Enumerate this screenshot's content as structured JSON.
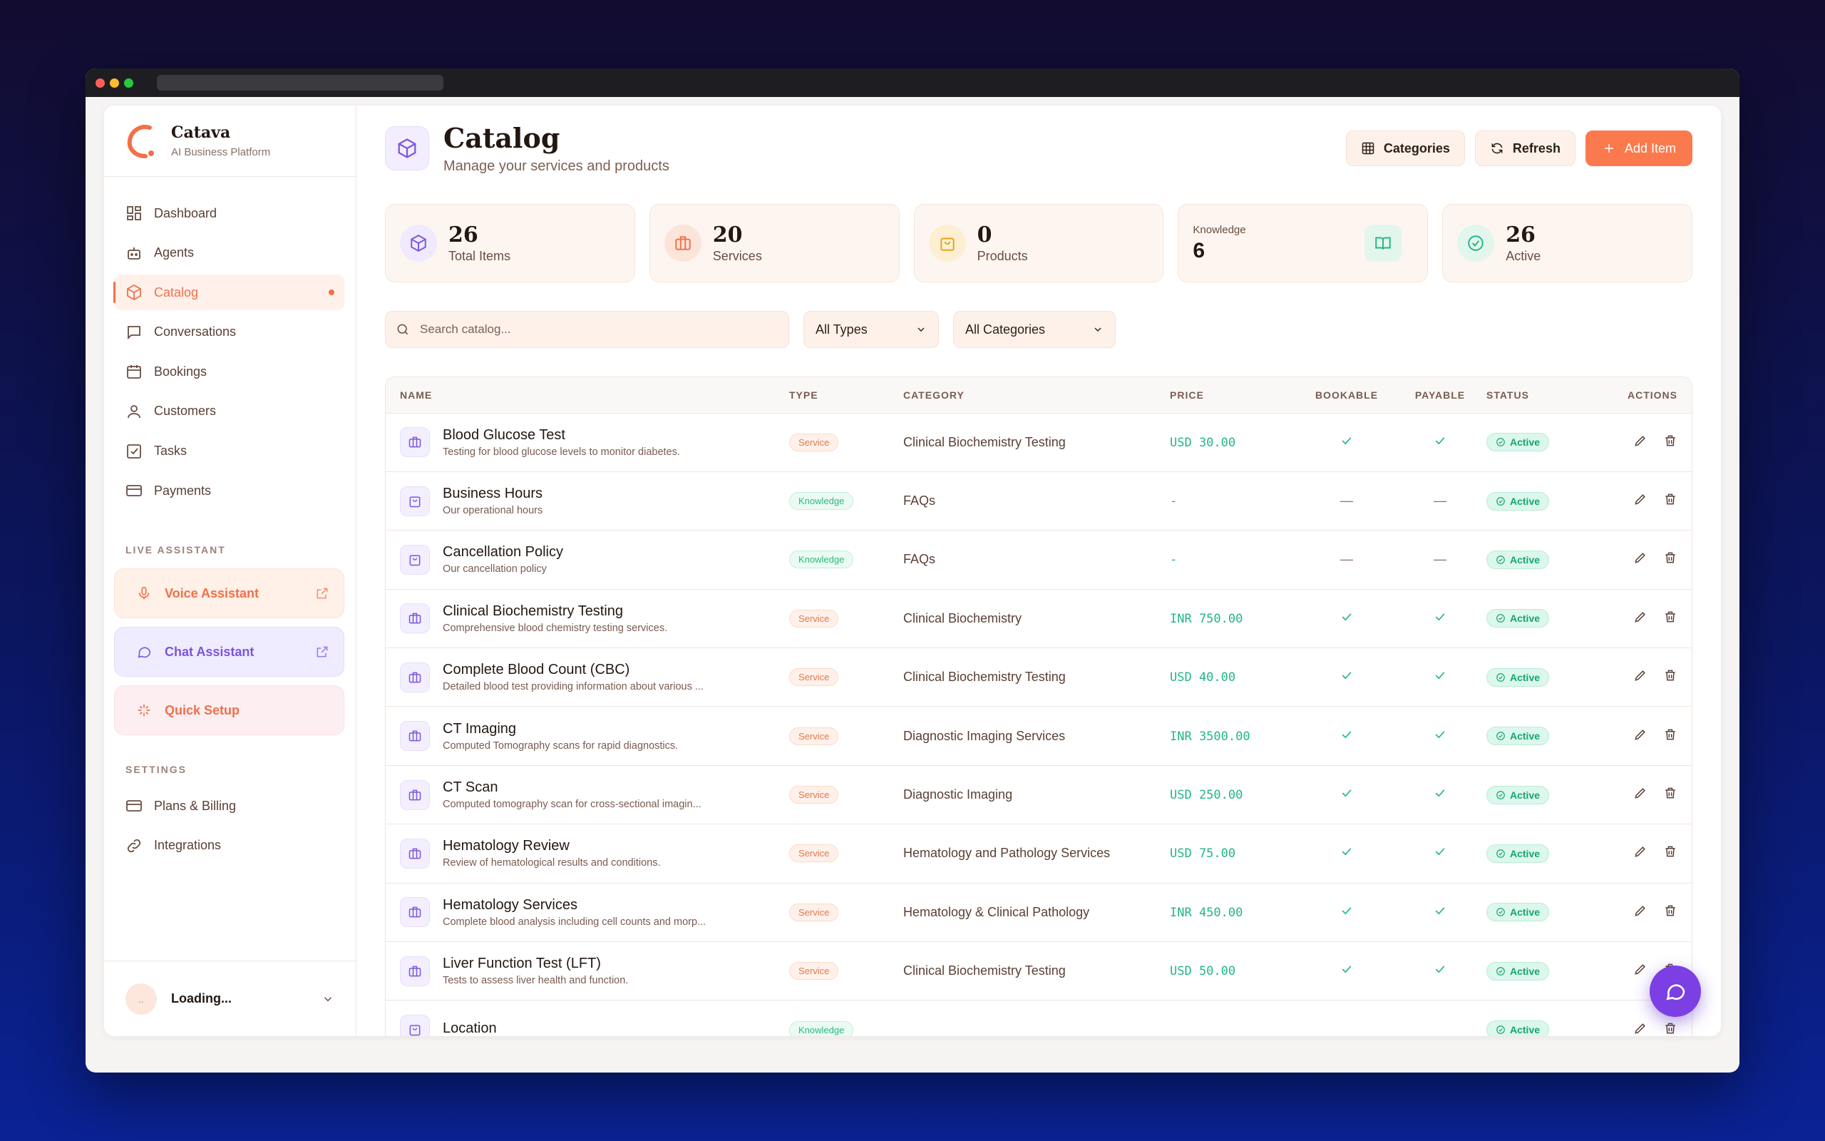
{
  "brand": {
    "name": "Catava",
    "subtitle": "AI Business Platform"
  },
  "nav": [
    {
      "label": "Dashboard",
      "icon": "dashboard-icon"
    },
    {
      "label": "Agents",
      "icon": "robot-icon"
    },
    {
      "label": "Catalog",
      "icon": "package-icon",
      "active": true
    },
    {
      "label": "Conversations",
      "icon": "message-icon"
    },
    {
      "label": "Bookings",
      "icon": "calendar-icon"
    },
    {
      "label": "Customers",
      "icon": "user-icon"
    },
    {
      "label": "Tasks",
      "icon": "checkbox-icon"
    },
    {
      "label": "Payments",
      "icon": "credit-card-icon"
    }
  ],
  "live_assistant": {
    "label": "LIVE ASSISTANT",
    "voice": "Voice Assistant",
    "chat": "Chat Assistant",
    "setup": "Quick Setup"
  },
  "settings": {
    "label": "SETTINGS",
    "plans": "Plans & Billing",
    "integrations": "Integrations"
  },
  "user": {
    "initials": "..",
    "name": "Loading..."
  },
  "page": {
    "title": "Catalog",
    "subtitle": "Manage your services and products",
    "categories_btn": "Categories",
    "refresh_btn": "Refresh",
    "add_btn": "Add Item"
  },
  "stats": {
    "total": {
      "value": "26",
      "label": "Total Items"
    },
    "services": {
      "value": "20",
      "label": "Services"
    },
    "products": {
      "value": "0",
      "label": "Products"
    },
    "knowledge": {
      "label": "Knowledge",
      "value": "6"
    },
    "active": {
      "value": "26",
      "label": "Active"
    }
  },
  "filters": {
    "search_placeholder": "Search catalog...",
    "type": "All Types",
    "category": "All Categories"
  },
  "table": {
    "headers": {
      "name": "NAME",
      "type": "TYPE",
      "category": "CATEGORY",
      "price": "PRICE",
      "bookable": "BOOKABLE",
      "payable": "PAYABLE",
      "status": "STATUS",
      "actions": "ACTIONS"
    },
    "rows": [
      {
        "name": "Blood Glucose Test",
        "desc": "Testing for blood glucose levels to monitor diabetes.",
        "type": "Service",
        "category": "Clinical Biochemistry Testing",
        "price": "USD 30.00",
        "bookable": true,
        "payable": true,
        "status": "Active"
      },
      {
        "name": "Business Hours",
        "desc": "Our operational hours",
        "type": "Knowledge",
        "category": "FAQs",
        "price": "-",
        "bookable": false,
        "payable": false,
        "status": "Active"
      },
      {
        "name": "Cancellation Policy",
        "desc": "Our cancellation policy",
        "type": "Knowledge",
        "category": "FAQs",
        "price": "-",
        "bookable": false,
        "payable": false,
        "status": "Active"
      },
      {
        "name": "Clinical Biochemistry Testing",
        "desc": "Comprehensive blood chemistry testing services.",
        "type": "Service",
        "category": "Clinical Biochemistry",
        "price": "INR 750.00",
        "bookable": true,
        "payable": true,
        "status": "Active"
      },
      {
        "name": "Complete Blood Count (CBC)",
        "desc": "Detailed blood test providing information about various ...",
        "type": "Service",
        "category": "Clinical Biochemistry Testing",
        "price": "USD 40.00",
        "bookable": true,
        "payable": true,
        "status": "Active"
      },
      {
        "name": "CT Imaging",
        "desc": "Computed Tomography scans for rapid diagnostics.",
        "type": "Service",
        "category": "Diagnostic Imaging Services",
        "price": "INR 3500.00",
        "bookable": true,
        "payable": true,
        "status": "Active"
      },
      {
        "name": "CT Scan",
        "desc": "Computed tomography scan for cross-sectional imagin...",
        "type": "Service",
        "category": "Diagnostic Imaging",
        "price": "USD 250.00",
        "bookable": true,
        "payable": true,
        "status": "Active"
      },
      {
        "name": "Hematology Review",
        "desc": "Review of hematological results and conditions.",
        "type": "Service",
        "category": "Hematology and Pathology Services",
        "price": "USD 75.00",
        "bookable": true,
        "payable": true,
        "status": "Active"
      },
      {
        "name": "Hematology Services",
        "desc": "Complete blood analysis including cell counts and morp...",
        "type": "Service",
        "category": "Hematology & Clinical Pathology",
        "price": "INR 450.00",
        "bookable": true,
        "payable": true,
        "status": "Active"
      },
      {
        "name": "Liver Function Test (LFT)",
        "desc": "Tests to assess liver health and function.",
        "type": "Service",
        "category": "Clinical Biochemistry Testing",
        "price": "USD 50.00",
        "bookable": true,
        "payable": true,
        "status": "Active"
      },
      {
        "name": "Location",
        "desc": "",
        "type": "Knowledge",
        "category": "",
        "price": "",
        "bookable": false,
        "payable": false,
        "status": "Active"
      }
    ]
  },
  "colors": {
    "accent": "#fa7a4e",
    "purple": "#7b55e0",
    "green": "#24b685"
  }
}
